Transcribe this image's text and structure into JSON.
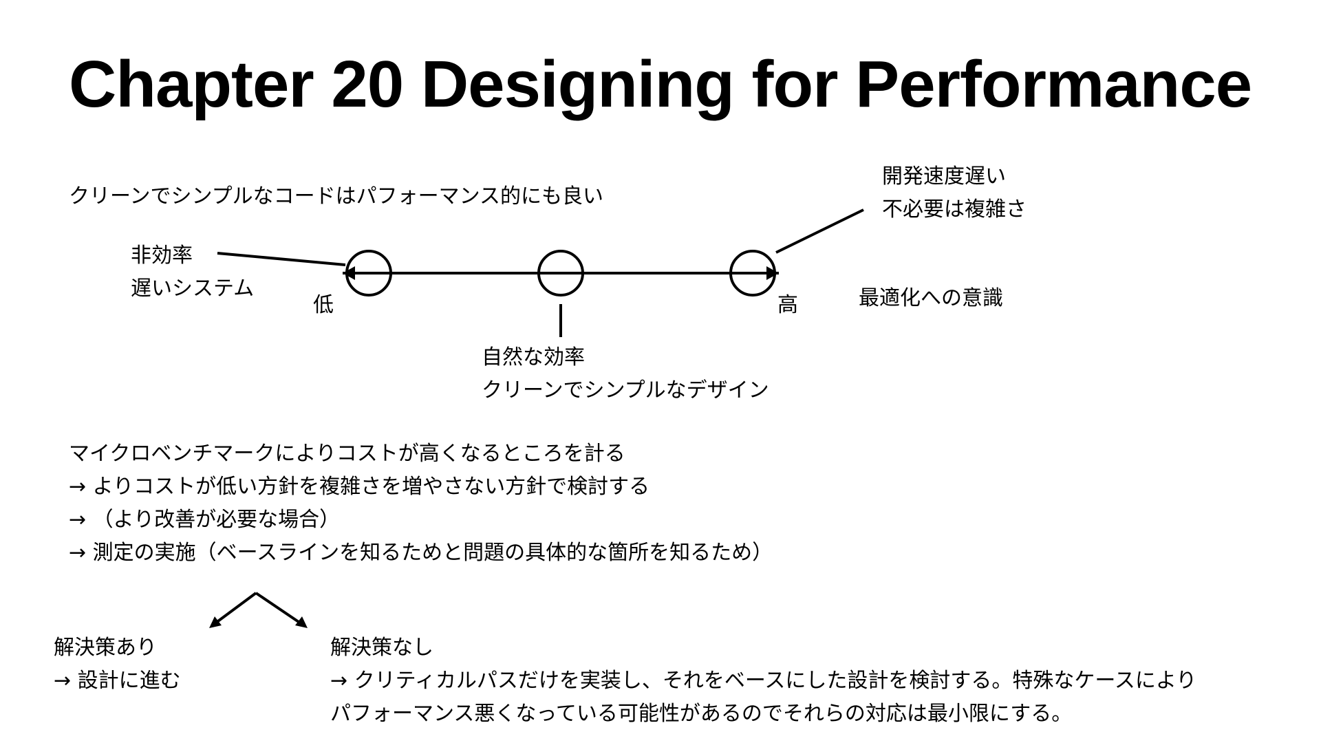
{
  "title": "Chapter 20 Designing for Performance",
  "intro": "クリーンでシンプルなコードはパフォーマンス的にも良い",
  "spectrum": {
    "left_note": [
      "非効率",
      "遅いシステム"
    ],
    "low_label": "低",
    "high_label": "高",
    "middle_note": [
      "自然な効率",
      "クリーンでシンプルなデザイン"
    ],
    "top_right_note": [
      "開発速度遅い",
      "不必要は複雑さ"
    ],
    "right_label": "最適化への意識"
  },
  "process": [
    "マイクロベンチマークによりコストが高くなるところを計る",
    "→ よりコストが低い方針を複雑さを増やさない方針で検討する",
    "→ （より改善が必要な場合）",
    "→ 測定の実施（ベースラインを知るためと問題の具体的な箇所を知るため）"
  ],
  "solution_yes": [
    "解決策あり",
    "→ 設計に進む"
  ],
  "solution_no": [
    "解決策なし",
    "→ クリティカルパスだけを実装し、それをベースにした設計を検討する。特殊なケースにより",
    "パフォーマンス悪くなっている可能性があるのでそれらの対応は最小限にする。"
  ]
}
